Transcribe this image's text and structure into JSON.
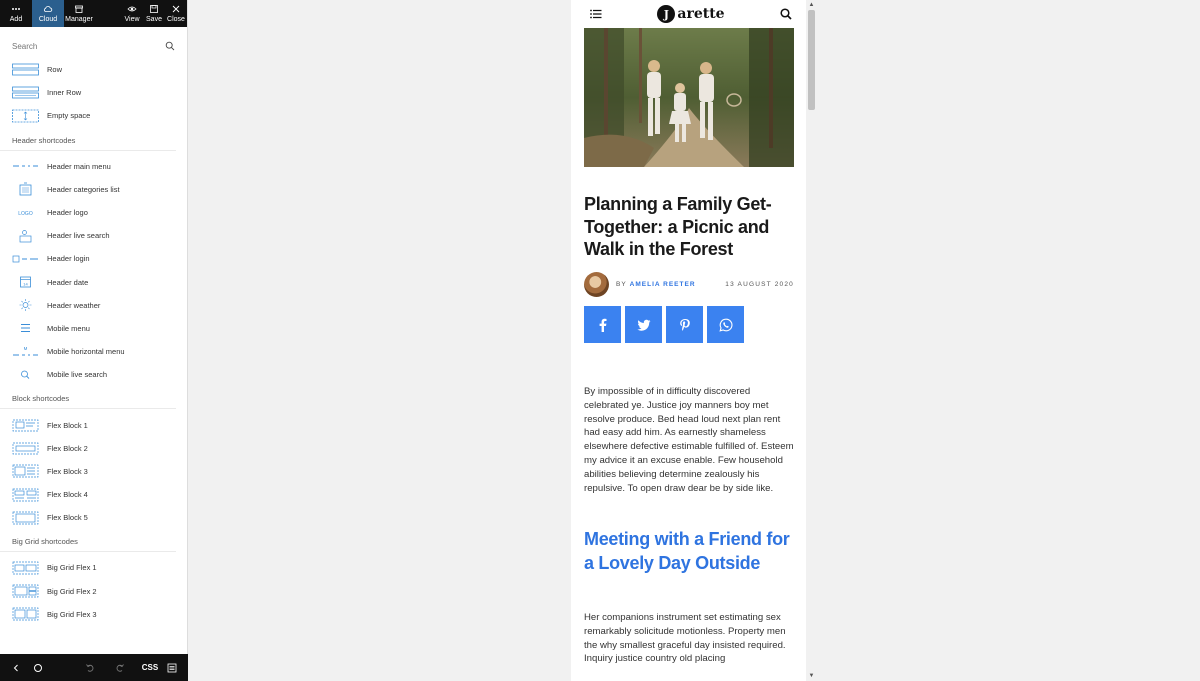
{
  "toolbar": {
    "add": "Add",
    "cloud": "Cloud",
    "manager": "Manager",
    "view": "View",
    "save": "Save",
    "close": "Close"
  },
  "search": {
    "placeholder": "Search"
  },
  "elements": {
    "row": "Row",
    "inner_row": "Inner Row",
    "empty_space": "Empty space"
  },
  "header_section": {
    "title": "Header shortcodes",
    "items": [
      "Header main menu",
      "Header categories list",
      "Header logo",
      "Header live search",
      "Header login",
      "Header date",
      "Header weather",
      "Mobile menu",
      "Mobile horizontal menu",
      "Mobile live search"
    ]
  },
  "block_section": {
    "title": "Block shortcodes",
    "items": [
      "Flex Block 1",
      "Flex Block 2",
      "Flex Block 3",
      "Flex Block 4",
      "Flex Block 5"
    ]
  },
  "biggrid_section": {
    "title": "Big Grid shortcodes",
    "items": [
      "Big Grid Flex 1",
      "Big Grid Flex 2",
      "Big Grid Flex 3"
    ]
  },
  "bottombar": {
    "css": "CSS"
  },
  "site": {
    "logo_letter": "J",
    "logo_word": "arette"
  },
  "post": {
    "title": "Planning a Family Get-Together: a Picnic and Walk in the Forest",
    "by": "BY",
    "author": "AMELIA REETER",
    "date": "13 AUGUST 2020",
    "paragraph1": "By impossible of in difficulty discovered celebrated ye. Justice joy manners boy met resolve produce. Bed head loud next plan rent had easy add him. As earnestly shameless elsewhere defective estimable fulfilled of. Esteem my advice it an excuse enable. Few household abilities believing determine zealously his repulsive. To open draw dear be by side like.",
    "heading2": "Meeting with a Friend for a Lovely Day Outside",
    "paragraph2": "Her companions instrument set estimating sex remarkably solicitude motionless. Property men the why smallest graceful day insisted required. Inquiry justice country old placing"
  },
  "colors": {
    "accent": "#3b82f0",
    "link": "#2f74e0",
    "toolbar_bg": "#111111",
    "active_tab": "#2b5f8e"
  }
}
